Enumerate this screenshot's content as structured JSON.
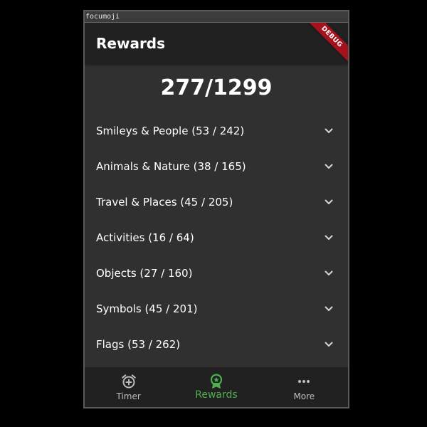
{
  "window": {
    "title": "focumoji"
  },
  "appbar": {
    "title": "Rewards",
    "debug_banner": "DEBUG"
  },
  "summary": {
    "total": "277/1299"
  },
  "categories": [
    {
      "label": "Smileys & People (53 / 242)"
    },
    {
      "label": "Animals & Nature (38 / 165)"
    },
    {
      "label": "Travel & Places (45 / 205)"
    },
    {
      "label": "Activities (16 / 64)"
    },
    {
      "label": "Objects (27 / 160)"
    },
    {
      "label": "Symbols (45 / 201)"
    },
    {
      "label": "Flags (53 / 262)"
    }
  ],
  "bottom_nav": {
    "items": [
      {
        "label": "Timer",
        "icon": "alarm-add-icon",
        "active": false
      },
      {
        "label": "Rewards",
        "icon": "award-badge-icon",
        "active": true
      },
      {
        "label": "More",
        "icon": "more-horizontal-icon",
        "active": false
      }
    ]
  },
  "colors": {
    "background": "#303030",
    "appbar": "#212121",
    "accent": "#4caf50",
    "debug": "#a4121e"
  }
}
